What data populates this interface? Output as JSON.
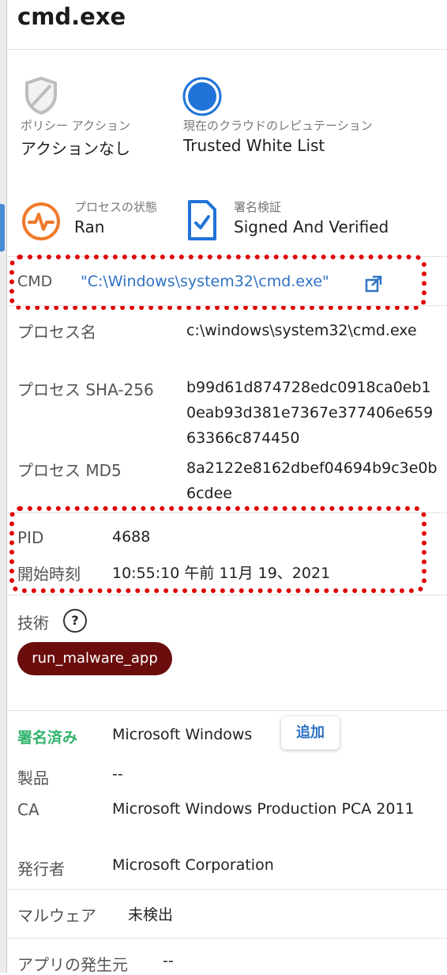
{
  "header": {
    "title": "cmd.exe"
  },
  "policy": {
    "label": "ポリシー アクション",
    "value": "アクションなし"
  },
  "reputation": {
    "label": "現在のクラウドのレピュテーション",
    "value": "Trusted White List"
  },
  "process_state": {
    "label": "プロセスの状態",
    "value": "Ran"
  },
  "signature": {
    "label": "署名検証",
    "value": "Signed And Verified"
  },
  "cmd": {
    "label": "CMD",
    "value": "\"C:\\Windows\\system32\\cmd.exe\""
  },
  "details": {
    "process_name_label": "プロセス名",
    "process_name_value": "c:\\windows\\system32\\cmd.exe",
    "sha_label": "プロセス SHA-256",
    "sha_value": "b99d61d874728edc0918ca0eb10eab93d381e7367e377406e65963366c874450",
    "md5_label": "プロセス MD5",
    "md5_value": "8a2122e8162dbef04694b9c3e0b6cdee"
  },
  "pid": {
    "label": "PID",
    "value": "4688"
  },
  "start_time": {
    "label": "開始時刻",
    "value": "10:55:10 午前 11月 19、2021"
  },
  "technique": {
    "label": "技術",
    "help": "?",
    "tag": "run_malware_app"
  },
  "signer": {
    "signed_label": "署名済み",
    "signed_value": "Microsoft Windows",
    "add_button": "追加",
    "product_label": "製品",
    "product_value": "--",
    "ca_label": "CA",
    "ca_value": "Microsoft Windows Production PCA 2011",
    "issuer_label": "発行者",
    "issuer_value": "Microsoft Corporation"
  },
  "malware": {
    "label": "マルウェア",
    "value": "未検出"
  },
  "origin": {
    "label": "アプリの発生元",
    "value": "--"
  },
  "colors": {
    "accent": "#2f72c4",
    "reputation": "#1f73d8",
    "state": "#f07a2a",
    "tag_bg": "#6b0d0d",
    "signed": "#2fb36b",
    "highlight": "#e00000"
  }
}
